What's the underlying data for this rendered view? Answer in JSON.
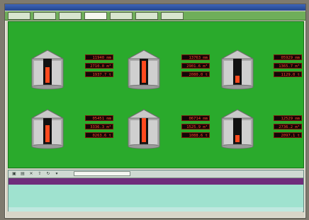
{
  "window": {
    "title": ""
  },
  "menu": {
    "items": [
      {
        "label": ""
      },
      {
        "label": ""
      },
      {
        "label": ""
      },
      {
        "label": ""
      },
      {
        "label": ""
      },
      {
        "label": ""
      },
      {
        "label": ""
      }
    ]
  },
  "panel": {
    "title": ""
  },
  "tanks": [
    {
      "name": "",
      "fill": 0.58,
      "rows": [
        {
          "label": "",
          "value": "11940 mm"
        },
        {
          "label": "",
          "value": "2710.0 m³"
        },
        {
          "label": "",
          "value": "1937.7 t"
        }
      ]
    },
    {
      "name": "",
      "fill": 0.82,
      "rows": [
        {
          "label": "",
          "value": "13763 mm"
        },
        {
          "label": "",
          "value": "2901.6 m³"
        },
        {
          "label": "",
          "value": "2080.0 t"
        }
      ]
    },
    {
      "name": "",
      "fill": 0.25,
      "rows": [
        {
          "label": "",
          "value": "05929 mm"
        },
        {
          "label": "",
          "value": "1365.7 m³"
        },
        {
          "label": "",
          "value": "1129.0 t"
        }
      ]
    },
    {
      "name": "",
      "fill": 0.62,
      "rows": [
        {
          "label": "",
          "value": "05451 mm"
        },
        {
          "label": "",
          "value": "3336.3 m³"
        },
        {
          "label": "",
          "value": "0263.6 t"
        }
      ]
    },
    {
      "name": "",
      "fill": 0.9,
      "rows": [
        {
          "label": "",
          "value": "06714 mm"
        },
        {
          "label": "",
          "value": "1525.9 m³"
        },
        {
          "label": "",
          "value": "1088.6 t"
        }
      ]
    },
    {
      "name": "",
      "fill": 0.25,
      "rows": [
        {
          "label": "",
          "value": "12529 mm"
        },
        {
          "label": "",
          "value": "2736.2 m³"
        },
        {
          "label": "",
          "value": "2097.1 t"
        }
      ]
    }
  ],
  "grid": {
    "dropdown": "",
    "columns": [
      "",
      "",
      "",
      "",
      "",
      "",
      "",
      "",
      "",
      "",
      "",
      "",
      "",
      ""
    ]
  },
  "status": {
    "left": "",
    "right": ""
  },
  "colors": {
    "panel": "#2aaa2c",
    "fill": "#ff4a1e",
    "readout_bg": "#140606",
    "readout_text": "#ff4a2a",
    "header": "#6f2d7b"
  },
  "icons": [
    "save-icon",
    "print-icon",
    "delete-icon",
    "export-icon",
    "refresh-icon",
    "filter-icon"
  ]
}
